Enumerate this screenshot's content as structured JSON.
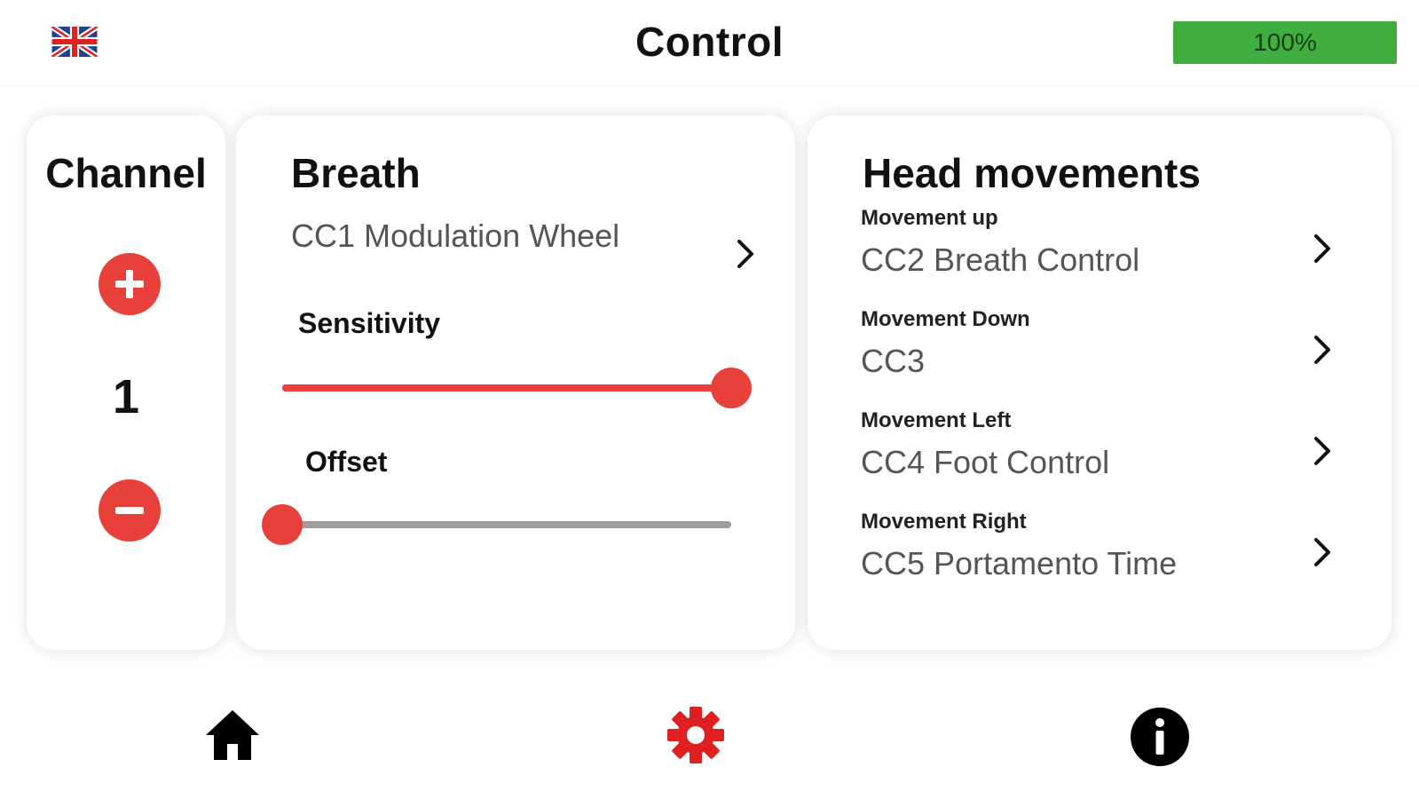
{
  "header": {
    "title": "Control",
    "battery": {
      "label": "100%",
      "level": 1.0,
      "color": "#3fae3f"
    },
    "language_icon": "uk-flag-icon"
  },
  "channel": {
    "title": "Channel",
    "value": "1",
    "increment_icon": "plus-icon",
    "decrement_icon": "minus-icon"
  },
  "breath": {
    "title": "Breath",
    "selected_cc": "CC1 Modulation Wheel",
    "sensitivity": {
      "label": "Sensitivity",
      "level": 1.0
    },
    "offset": {
      "label": "Offset",
      "level": 0.0
    }
  },
  "head_movements": {
    "title": "Head movements",
    "items": [
      {
        "label": "Movement up",
        "value": "CC2 Breath Control"
      },
      {
        "label": "Movement Down",
        "value": "CC3"
      },
      {
        "label": "Movement Left",
        "value": "CC4 Foot Control"
      },
      {
        "label": "Movement Right",
        "value": "CC5 Portamento Time"
      }
    ]
  },
  "nav": {
    "items": [
      {
        "icon": "home-icon",
        "active": false
      },
      {
        "icon": "gear-icon",
        "active": true
      },
      {
        "icon": "info-icon",
        "active": false
      }
    ]
  },
  "colors": {
    "accent": "#e8403a",
    "battery": "#3fae3f",
    "track_inactive": "#9e9e9e"
  }
}
